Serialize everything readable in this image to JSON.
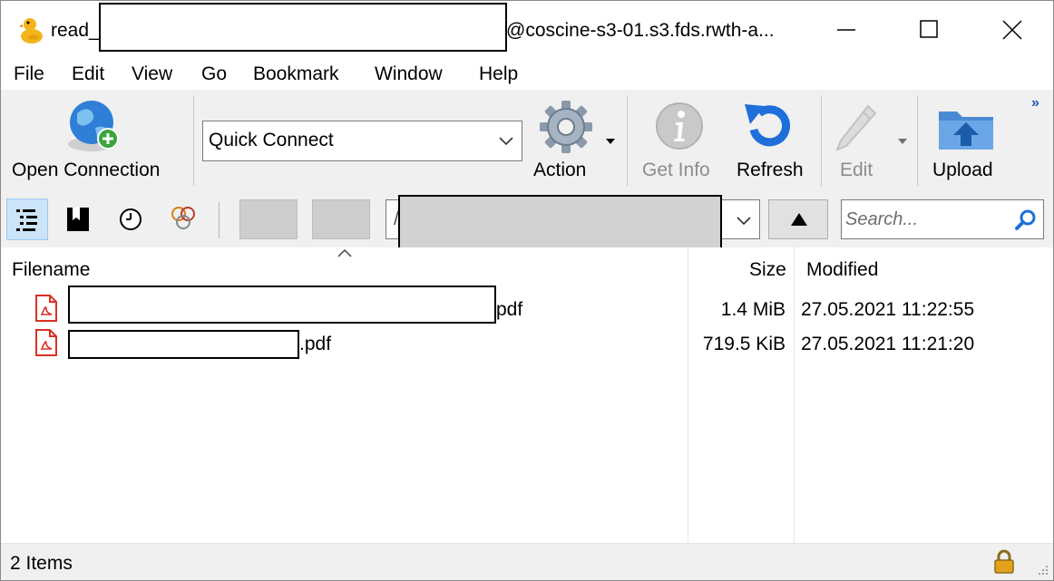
{
  "window": {
    "title_prefix": "read_",
    "title_suffix": "@coscine-s3-01.s3.fds.rwth-a...",
    "minimize_label": "Minimize",
    "maximize_label": "Maximize",
    "close_label": "Close"
  },
  "menu": {
    "items": [
      "File",
      "Edit",
      "View",
      "Go",
      "Bookmark",
      "Window",
      "Help"
    ]
  },
  "toolbar": {
    "open_connection": "Open Connection",
    "quick_connect_value": "Quick Connect",
    "action": "Action",
    "get_info": "Get Info",
    "refresh": "Refresh",
    "edit": "Edit",
    "upload": "Upload",
    "overflow": "»"
  },
  "navbar": {
    "path_prefix": "/",
    "search_placeholder": "Search..."
  },
  "filelist": {
    "columns": {
      "filename": "Filename",
      "size": "Size",
      "modified": "Modified"
    },
    "rows": [
      {
        "name_suffix": "pdf",
        "size": "1.4 MiB",
        "modified": "27.05.2021 11:22:55"
      },
      {
        "name_suffix": ".pdf",
        "size": "719.5 KiB",
        "modified": "27.05.2021 11:21:20"
      }
    ]
  },
  "status": {
    "items_count": "2 Items"
  },
  "colors": {
    "toolbar_bg": "#f0f0f0",
    "accent_blue": "#1e6fd9",
    "pdf_red": "#d93025",
    "nav_toggle_active": "#cce4f7"
  },
  "icons": {
    "app": "duck-icon",
    "open_connection": "globe-plus-icon",
    "action": "gear-icon",
    "get_info": "info-icon",
    "refresh": "refresh-icon",
    "edit": "pencil-icon",
    "upload": "folder-upload-icon",
    "search": "search-icon",
    "lock": "lock-icon"
  }
}
